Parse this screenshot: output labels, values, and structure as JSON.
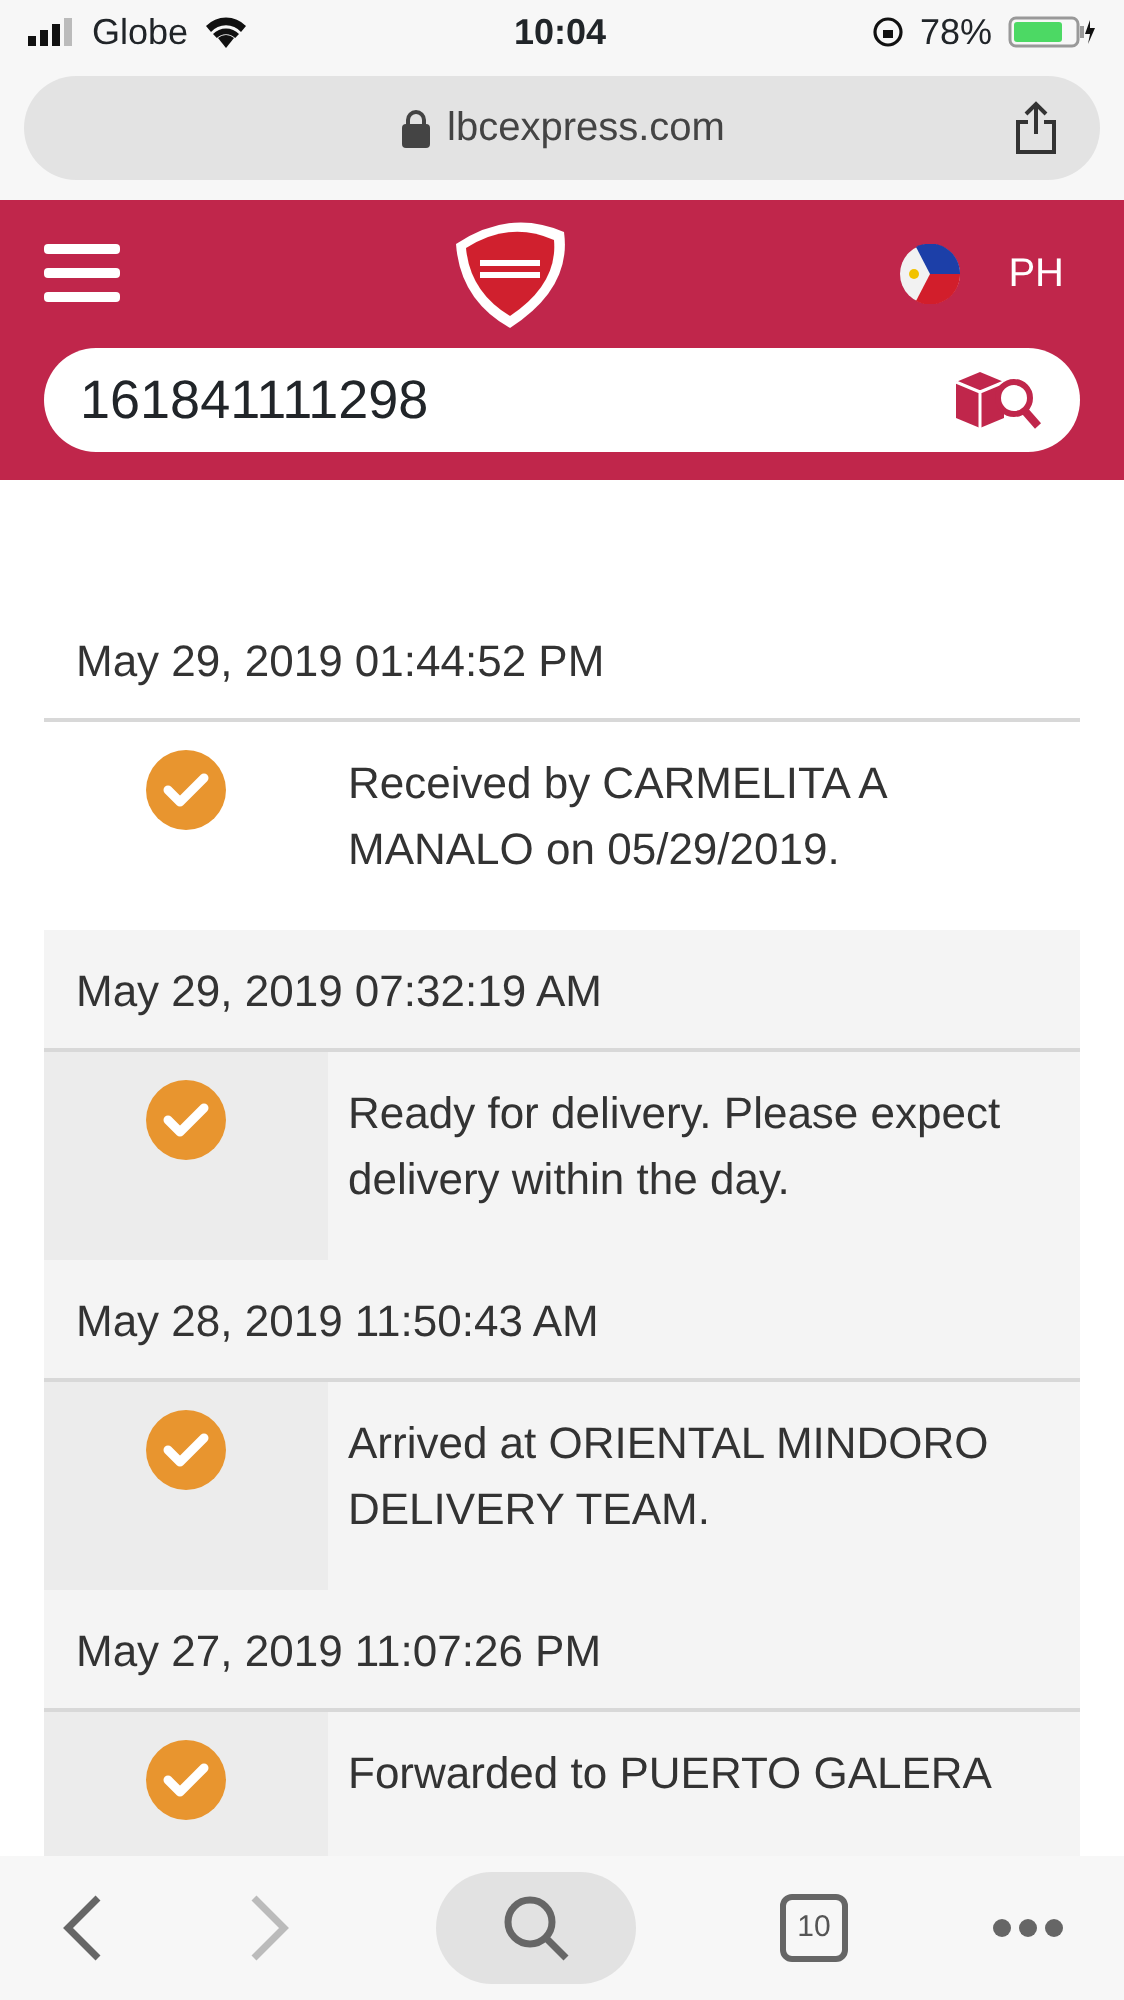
{
  "status_bar": {
    "carrier": "Globe",
    "time": "10:04",
    "battery": "78%"
  },
  "browser": {
    "url": "lbcexpress.com"
  },
  "header": {
    "country": "PH",
    "tracking_number": "161841111298"
  },
  "events": [
    {
      "date": "May 29, 2019 01:44:52 PM",
      "text": "Received by CARMELITA A MANALO on 05/29/2019.",
      "shaded": false
    },
    {
      "date": "May 29, 2019 07:32:19 AM",
      "text": "Ready for delivery. Please expect delivery within the day.",
      "shaded": true
    },
    {
      "date": "May 28, 2019 11:50:43 AM",
      "text": "Arrived at ORIENTAL MINDORO DELIVERY TEAM.",
      "shaded": true
    },
    {
      "date": "May 27, 2019 11:07:26 PM",
      "text": "Forwarded to PUERTO GALERA",
      "shaded": true
    }
  ],
  "toolbar": {
    "tab_count": "10"
  }
}
